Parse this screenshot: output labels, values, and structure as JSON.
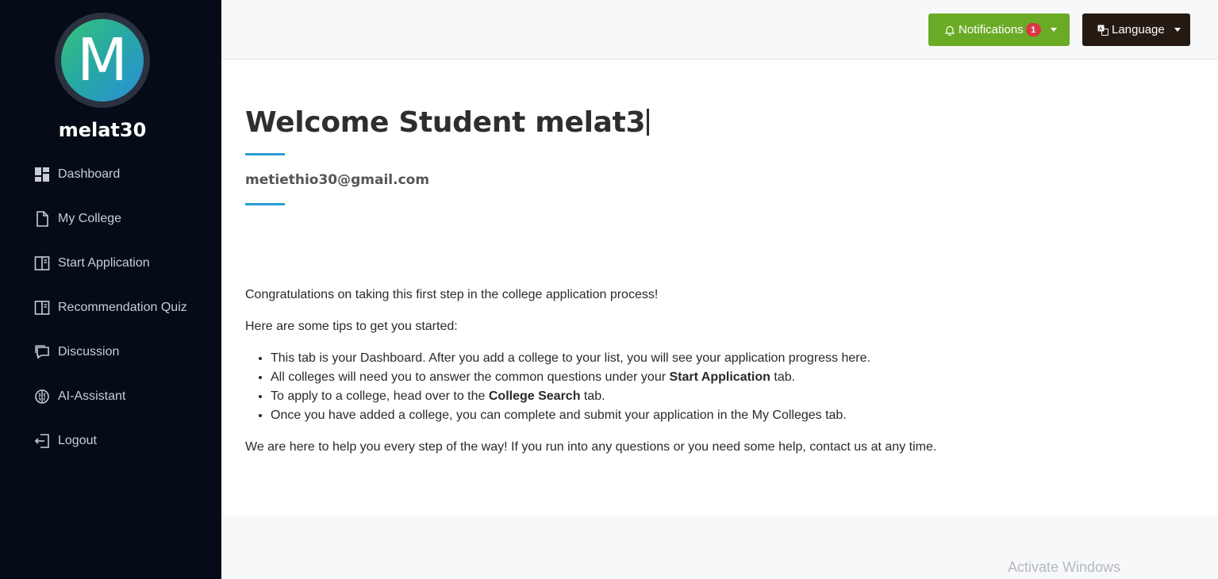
{
  "sidebar": {
    "avatar_letter": "M",
    "username": "melat30",
    "items": [
      {
        "label": "Dashboard",
        "icon": "dashboard-icon"
      },
      {
        "label": "My College",
        "icon": "file-icon"
      },
      {
        "label": "Start Application",
        "icon": "layout-icon"
      },
      {
        "label": "Recommendation Quiz",
        "icon": "layout-icon"
      },
      {
        "label": "Discussion",
        "icon": "chat-icon"
      },
      {
        "label": "AI-Assistant",
        "icon": "brain-icon"
      },
      {
        "label": "Logout",
        "icon": "logout-icon"
      }
    ]
  },
  "topbar": {
    "notifications_label": "Notifications",
    "notifications_count": "1",
    "language_label": "Language"
  },
  "main": {
    "welcome": "Welcome Student melat3",
    "email": "metiethio30@gmail.com",
    "intro": "Congratulations on taking this first step in the college application process!",
    "tips_heading": "Here are some tips to get you started:",
    "tip1": "This tab is your Dashboard. After you add a college to your list, you will see your application progress here.",
    "tip2_pre": "All colleges will need you to answer the common questions under your ",
    "tip2_bold": "Start Application",
    "tip2_post": " tab.",
    "tip3_pre": "To apply to a college, head over to the ",
    "tip3_bold": "College Search",
    "tip3_post": " tab.",
    "tip4": "Once you have added a college, you can complete and submit your application in the My Colleges tab.",
    "closing": "We are here to help you every step of the way! If you run into any questions or you need some help, contact us at any time."
  },
  "watermark": "Activate Windows",
  "colors": {
    "sidebar_bg": "#050c17",
    "notifications_bg": "#6aab25",
    "language_bg": "#251a12",
    "accent_rule": "#2d9bd6",
    "badge": "#dc3545"
  }
}
